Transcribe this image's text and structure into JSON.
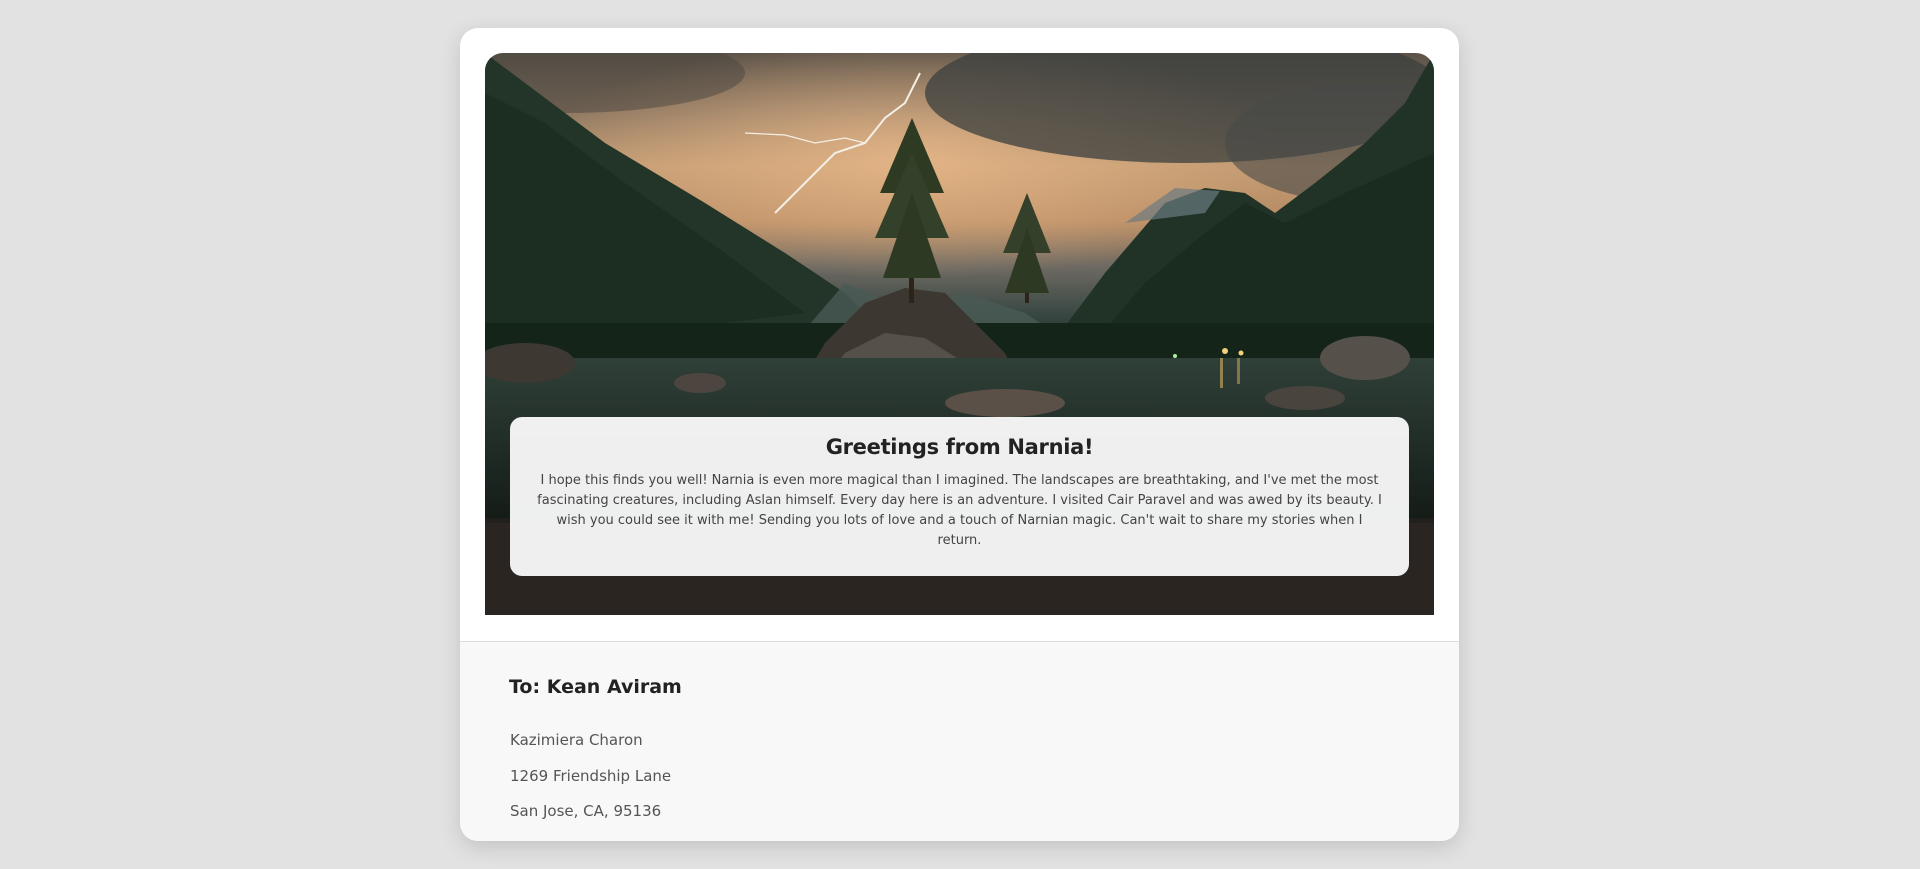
{
  "postcard": {
    "title": "Greetings from Narnia!",
    "message": "I hope this finds you well! Narnia is even more magical than I imagined. The landscapes are breathtaking, and I've met the most fascinating creatures, including Aslan himself. Every day here is an adventure. I visited Cair Paravel and was awed by its beauty. I wish you could see it with me! Sending you lots of love and a touch of Narnian magic. Can't wait to share my stories when I return.",
    "recipient_line": "To: Kean Aviram",
    "address": {
      "name": "Kazimiera Charon",
      "street": "1269 Friendship Lane",
      "city_line": "San Jose, CA, 95136"
    }
  },
  "colors": {
    "background": "#e2e2e2",
    "card": "#ffffff",
    "address_panel": "#f8f8f8",
    "title_text": "#222222",
    "body_text": "#444444"
  }
}
